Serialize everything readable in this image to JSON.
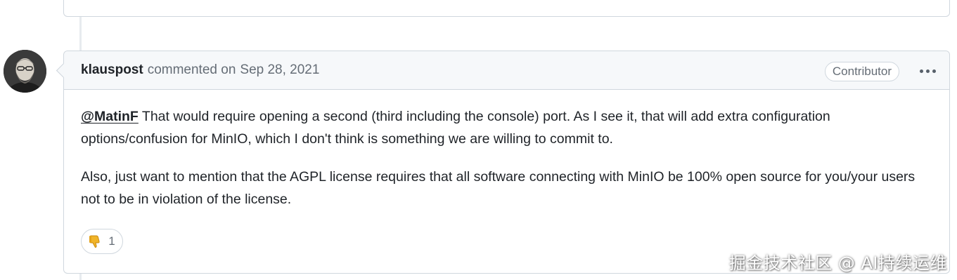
{
  "comment": {
    "author": "klauspost",
    "action": "commented on",
    "date": "Sep 28, 2021",
    "role_badge": "Contributor",
    "more_menu_icon": "kebab-horizontal-icon",
    "body": {
      "mention": "@MatinF",
      "paragraph1_rest": " That would require opening a second (third including the console) port. As I see it, that will add extra configuration options/confusion for MinIO, which I don't think is something we are willing to commit to.",
      "paragraph2": "Also, just want to mention that the AGPL license requires that all software connecting with MinIO be 100% open source for you/your users not to be in violation of the license."
    },
    "reaction": {
      "icon": "thumbs-down-icon",
      "count": "1"
    }
  },
  "watermark": "掘金技术社区 @ AI持续运维",
  "colors": {
    "border": "#d0d7de",
    "header_bg": "#f6f8fa",
    "muted_text": "#656d76",
    "thumbs_down": "#e3a21a"
  }
}
